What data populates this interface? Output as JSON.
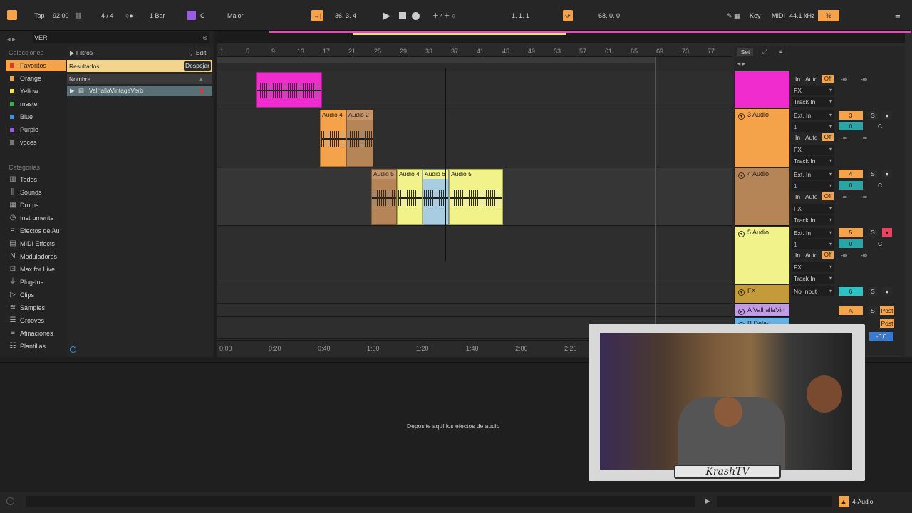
{
  "topbar": {
    "tap": "Tap",
    "bpm": "92.00",
    "meter": "4 / 4",
    "quant": "1 Bar",
    "key_root": "C",
    "scale": "Major",
    "position": "36.  3.  4",
    "loop_start": "1.  1.  1",
    "loop_len": "68.  0.  0",
    "key_label": "Key",
    "midi_label": "MIDI",
    "sample_rate": "44.1 kHz",
    "cpu": "%"
  },
  "browser": {
    "search": "VER",
    "collections_head": "Colecciones",
    "collections": [
      {
        "label": "Favoritos",
        "color": "#e0362d"
      },
      {
        "label": "Orange",
        "color": "#f5a34a"
      },
      {
        "label": "Yellow",
        "color": "#f2e34c"
      },
      {
        "label": "master",
        "color": "#35b24a"
      },
      {
        "label": "Blue",
        "color": "#3a8fe0"
      },
      {
        "label": "Purple",
        "color": "#9a5de0"
      },
      {
        "label": "voces",
        "color": "#777777"
      }
    ],
    "categories_head": "Categorías",
    "categories": [
      {
        "label": "Todos",
        "icon": "grid-icon"
      },
      {
        "label": "Sounds",
        "icon": "bars-icon"
      },
      {
        "label": "Drums",
        "icon": "drum-icon"
      },
      {
        "label": "Instruments",
        "icon": "clock-icon"
      },
      {
        "label": "Efectos de Au",
        "icon": "fx-icon"
      },
      {
        "label": "MIDI Effects",
        "icon": "midi-icon"
      },
      {
        "label": "Moduladores",
        "icon": "mod-icon"
      },
      {
        "label": "Max for Live",
        "icon": "max-icon"
      },
      {
        "label": "Plug-Ins",
        "icon": "plug-icon"
      },
      {
        "label": "Clips",
        "icon": "play-icon"
      },
      {
        "label": "Samples",
        "icon": "wave-icon"
      },
      {
        "label": "Grooves",
        "icon": "groove-icon"
      },
      {
        "label": "Afinaciones",
        "icon": "tune-icon"
      },
      {
        "label": "Plantillas",
        "icon": "template-icon"
      }
    ],
    "filters": "Filtros",
    "edit": "Edit",
    "results": "Resultados",
    "clear": "Despejar",
    "name_col": "Nombre",
    "result_item": "ValhallaVintageVerb"
  },
  "ruler": [
    "1",
    "5",
    "9",
    "13",
    "17",
    "21",
    "25",
    "29",
    "33",
    "37",
    "41",
    "45",
    "49",
    "53",
    "57",
    "61",
    "65",
    "69",
    "73",
    "77"
  ],
  "time_ruler": [
    "0:00",
    "0:20",
    "0:40",
    "1:00",
    "1:20",
    "1:40",
    "2:00",
    "2:20"
  ],
  "clips": [
    {
      "name": "",
      "color": "#f02ccf"
    },
    {
      "name": "Audio 4",
      "color": "#f5a34a"
    },
    {
      "name": "Audio 2",
      "color": "#b58557"
    },
    {
      "name": "Audio 5",
      "color": "#b58557"
    },
    {
      "name": "Audio 4",
      "color": "#f2f28a"
    },
    {
      "name": "Audio 6",
      "color": "#a8cce0"
    },
    {
      "name": "Audio 5",
      "color": "#f2f28a"
    }
  ],
  "set_label": "Set",
  "tracks": [
    {
      "name": "",
      "color": "#f02ccf"
    },
    {
      "name": "3 Audio",
      "color": "#f5a34a",
      "num": "3"
    },
    {
      "name": "4 Audio",
      "color": "#b58557",
      "num": "4"
    },
    {
      "name": "5 Audio",
      "color": "#f2f28a",
      "num": "5"
    },
    {
      "name": "FX",
      "color": "#c59a3a",
      "num": "6",
      "input": "No Input"
    },
    {
      "name": "A ValhallaVin",
      "color": "#c19be8",
      "num": "A"
    },
    {
      "name": "B Delay",
      "color": "#6ab0e0",
      "num": "B"
    }
  ],
  "io": {
    "ext_in": "Ext. In",
    "ch": "1",
    "in": "In",
    "auto": "Auto",
    "off": "Off",
    "fx": "FX",
    "track_in": "Track In",
    "inf": "-∞",
    "s": "S",
    "c": "C",
    "zero": "0",
    "post": "Post",
    "db": "-6.0"
  },
  "device_drop": "Deposite aquí los efectos de audio",
  "status": {
    "track": "4-Audio"
  },
  "cam": {
    "logo": "KrashTV"
  }
}
